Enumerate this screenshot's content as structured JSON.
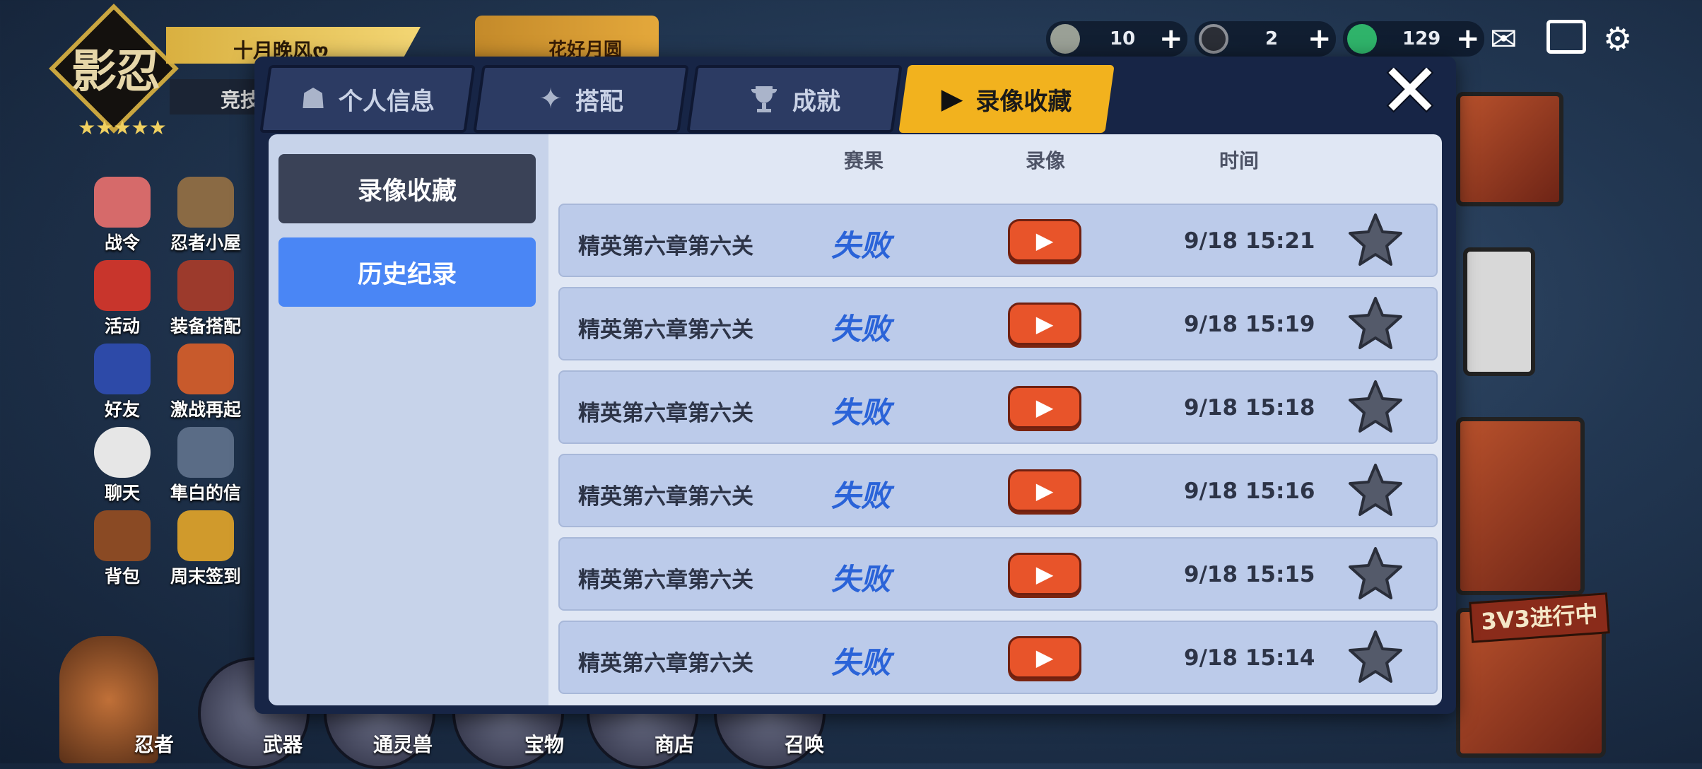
{
  "background": {
    "logo_text": "影忍",
    "logo_stars": "★★★★★",
    "banner_title": "十月晚风ღ",
    "banner_sub": "竞技",
    "event_title": "花好月圆",
    "resources": [
      {
        "icon": "rice-ball-icon",
        "value": "10"
      },
      {
        "icon": "coin-icon",
        "value": "2"
      },
      {
        "icon": "jade-icon",
        "value": "129"
      }
    ],
    "plus": "+",
    "top_icons": [
      "mail-icon",
      "shop-icon",
      "settings-icon"
    ],
    "side_menu": [
      {
        "label": "战令"
      },
      {
        "label": "忍者小屋"
      },
      {
        "label": "活动"
      },
      {
        "label": "装备搭配"
      },
      {
        "label": "好友"
      },
      {
        "label": "激战再起"
      },
      {
        "label": "聊天"
      },
      {
        "label": "隼白的信"
      },
      {
        "label": "背包"
      },
      {
        "label": "周末签到"
      }
    ],
    "pvp_banner": "3V3进行中",
    "bottom_nav": [
      {
        "label": "忍者"
      },
      {
        "label": "武器"
      },
      {
        "label": "通灵兽"
      },
      {
        "label": "宝物"
      },
      {
        "label": "商店"
      },
      {
        "label": "召唤"
      }
    ]
  },
  "modal": {
    "tabs": [
      {
        "label": "个人信息",
        "icon": "profile-icon",
        "active": false
      },
      {
        "label": "搭配",
        "icon": "shuriken-icon",
        "active": false
      },
      {
        "label": "成就",
        "icon": "trophy-icon",
        "active": false
      },
      {
        "label": "录像收藏",
        "icon": "play-icon",
        "active": true
      }
    ],
    "close_glyph": "✕",
    "sidebar": [
      {
        "label": "录像收藏",
        "selected": false
      },
      {
        "label": "历史纪录",
        "selected": true
      }
    ],
    "columns": {
      "result": "赛果",
      "video": "录像",
      "time": "时间"
    },
    "rows": [
      {
        "title": "精英第六章第六关",
        "result": "失败",
        "time": "9/18 15:21"
      },
      {
        "title": "精英第六章第六关",
        "result": "失败",
        "time": "9/18 15:19"
      },
      {
        "title": "精英第六章第六关",
        "result": "失败",
        "time": "9/18 15:18"
      },
      {
        "title": "精英第六章第六关",
        "result": "失败",
        "time": "9/18 15:16"
      },
      {
        "title": "精英第六章第六关",
        "result": "失败",
        "time": "9/18 15:15"
      },
      {
        "title": "精英第六章第六关",
        "result": "失败",
        "time": "9/18 15:14"
      }
    ],
    "play_glyph": "▶",
    "colors": {
      "active_tab": "#f2b21e",
      "selected_side": "#4a86f5",
      "result_text": "#2a63d8",
      "play_button": "#e8542a"
    }
  }
}
